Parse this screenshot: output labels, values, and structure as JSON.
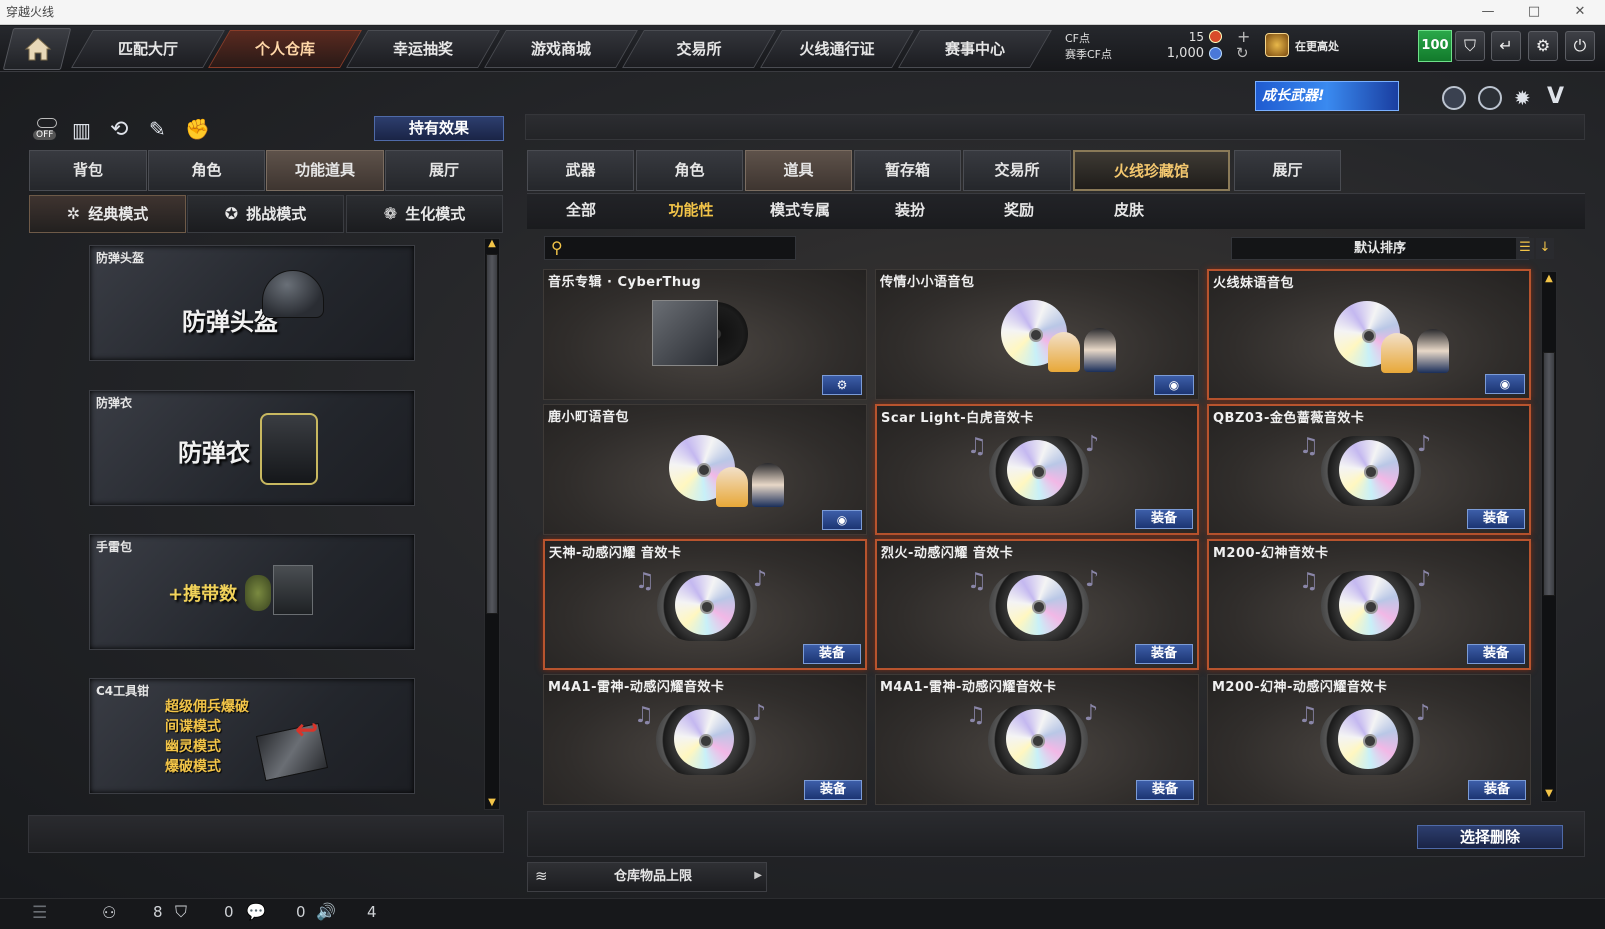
{
  "window": {
    "title": "穿越火线",
    "min": "—",
    "max": "□",
    "close": "✕"
  },
  "nav": [
    "匹配大厅",
    "个人仓库",
    "幸运抽奖",
    "游戏商城",
    "交易所",
    "火线通行证",
    "赛事中心"
  ],
  "currency": {
    "cf_label": "CF点",
    "season_label": "赛季CF点",
    "cf_value": "15",
    "season_value": "1,000"
  },
  "rank_text": "在更高处",
  "level_badge": "100",
  "growth_banner": "成长武器!",
  "toggle_off": "OFF",
  "effects_button": "持有效果",
  "left_tabs": [
    "背包",
    "角色",
    "功能道具",
    "展厅"
  ],
  "left_tabs_active": 2,
  "modes": [
    "经典模式",
    "挑战模式",
    "生化模式"
  ],
  "left_items": [
    {
      "label": "防弹头盔",
      "big": "防弹头盔"
    },
    {
      "label": "防弹衣",
      "big": "防弹衣"
    },
    {
      "label": "手雷包",
      "big": "+携带数"
    },
    {
      "label": "C4工具钳",
      "lines": [
        "超级佣兵爆破",
        "间谍模式",
        "幽灵模式",
        "爆破模式"
      ]
    }
  ],
  "right_tabs": [
    "武器",
    "角色",
    "道具",
    "暂存箱",
    "交易所",
    "火线珍藏馆",
    "展厅"
  ],
  "right_tabs_active": 2,
  "sub_tabs": [
    "全部",
    "功能性",
    "模式专属",
    "装扮",
    "奖励",
    "皮肤"
  ],
  "sub_tabs_active": 1,
  "search": {
    "placeholder": ""
  },
  "sort_label": "默认排序",
  "equip_label": "装备",
  "items": [
    {
      "name": "音乐专辑 · CyberThug",
      "type": "album",
      "button": "⚙",
      "highlight": false
    },
    {
      "name": "传情小小语音包",
      "type": "voice",
      "button": "◉",
      "highlight": false
    },
    {
      "name": "火线妹语音包",
      "type": "voice",
      "button": "◉",
      "highlight": true
    },
    {
      "name": "鹿小町语音包",
      "type": "voice",
      "button": "◉",
      "highlight": false
    },
    {
      "name": "Scar Light-白虎音效卡",
      "type": "sound",
      "button": "装备",
      "highlight": true
    },
    {
      "name": "QBZ03-金色蔷薇音效卡",
      "type": "sound",
      "button": "装备",
      "highlight": true
    },
    {
      "name": "天神-动感闪耀 音效卡",
      "type": "sound",
      "button": "装备",
      "highlight": true
    },
    {
      "name": "烈火-动感闪耀 音效卡",
      "type": "sound",
      "button": "装备",
      "highlight": true
    },
    {
      "name": "M200-幻神音效卡",
      "type": "sound",
      "button": "装备",
      "highlight": true
    },
    {
      "name": "M4A1-雷神-动感闪耀音效卡",
      "type": "sound",
      "button": "装备",
      "highlight": false
    },
    {
      "name": "M4A1-雷神-动感闪耀音效卡",
      "type": "sound",
      "button": "装备",
      "highlight": false
    },
    {
      "name": "M200-幻神-动感闪耀音效卡",
      "type": "sound",
      "button": "装备",
      "highlight": false
    }
  ],
  "delete_button": "选择删除",
  "storage_limit": "仓库物品上限",
  "status": {
    "friends": "8",
    "clan": "0",
    "chat": "0",
    "voice": "4"
  }
}
